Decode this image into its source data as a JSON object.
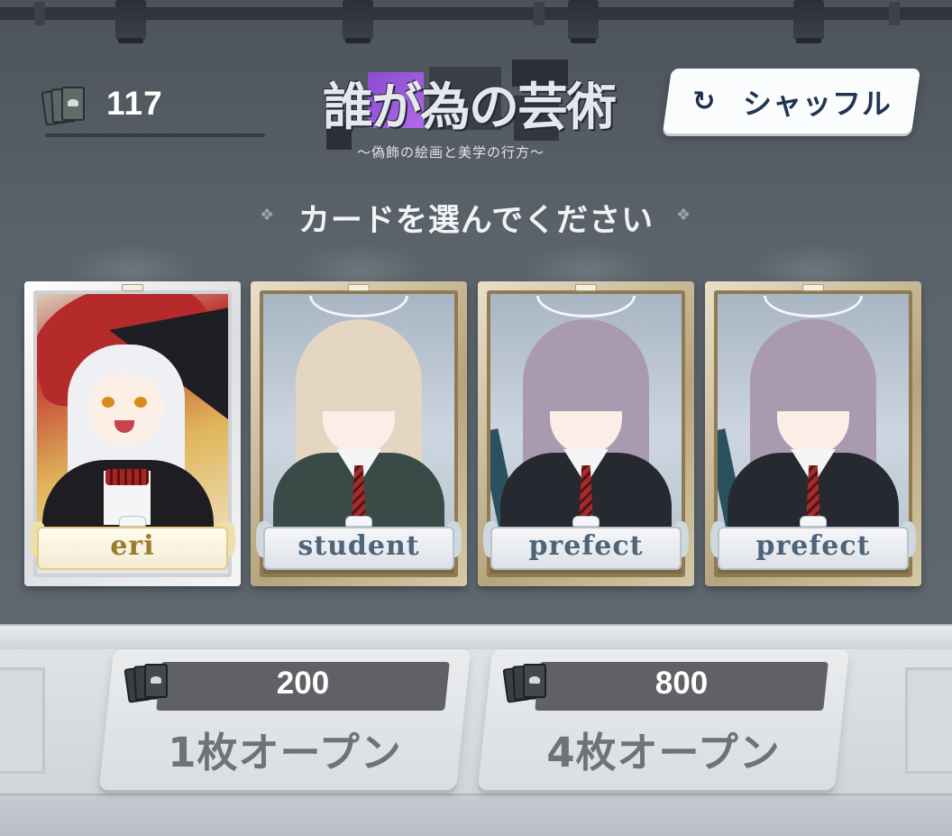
{
  "deck": {
    "count": "117"
  },
  "title": {
    "main": "誰が為の芸術",
    "subtitle": "〜偽飾の絵画と美学の行方〜"
  },
  "shuffle_button": {
    "label": "シャッフル"
  },
  "instruction": "カードを選んでください",
  "cards": [
    {
      "name": "eri",
      "style": "silver"
    },
    {
      "name": "student",
      "style": "gold"
    },
    {
      "name": "prefect",
      "style": "gold"
    },
    {
      "name": "prefect",
      "style": "gold"
    }
  ],
  "open_buttons": [
    {
      "cost": "200",
      "label": "1枚オープン"
    },
    {
      "cost": "800",
      "label": "4枚オープン"
    }
  ],
  "icons": {
    "deck": "card-stack-icon",
    "shuffle": "refresh-icon"
  },
  "colors": {
    "wall": "#5a6068",
    "accent_text": "#213552",
    "gold_frame": "#b6a47d"
  }
}
